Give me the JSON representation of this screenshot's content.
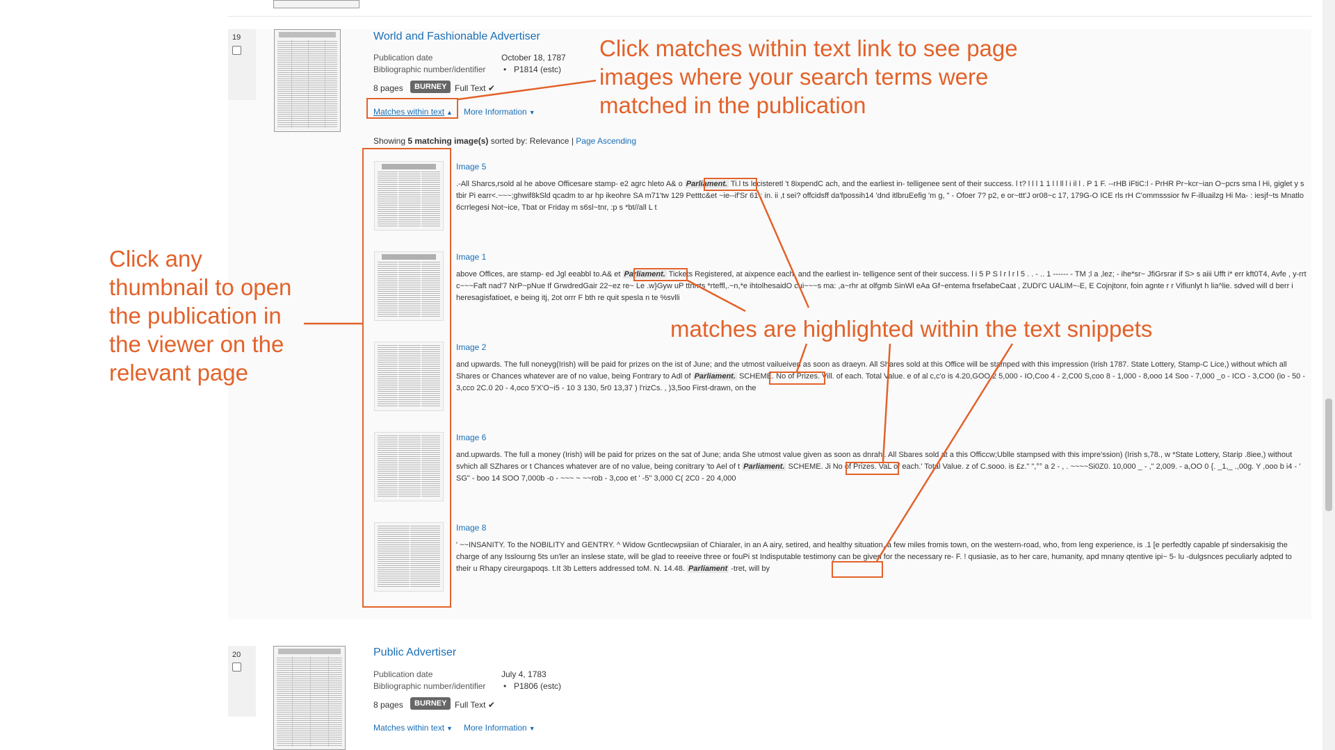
{
  "results": [
    {
      "number": "19",
      "title": "World and Fashionable Advertiser",
      "publication_date_label": "Publication date",
      "publication_date": "October 18, 1787",
      "biblio_label": "Bibliographic number/identifier",
      "biblio_value": "P1814 (estc)",
      "pages": "8 pages",
      "badge": "BURNEY",
      "full_text": "Full Text",
      "matches_link": "Matches within text",
      "more_info": "More Information",
      "showing_prefix": "Showing",
      "showing_count": "5 matching image(s)",
      "showing_suffix": "sorted by: Relevance |",
      "page_ascending": "Page Ascending",
      "images": [
        {
          "label": "Image 5",
          "before": ".-All Sharcs,rsold al he above Officesare stamp- e2 agrc hleto A& o",
          "match": "Parliament.",
          "after": "Ti.l ts lecisteretl 't 8ixpendC ach, and the earliest in- telligenee sent of their success. l t? l l l 1 1 l l ll l i il l . P 1 F. --rHB iFtiC:l - PrHR Pr~kcr~ian O~pcrs sma l Hi, giglet y s tbir Pi earr<.~~~;ghwif8kSld qcadm to ar hp ikeohre SA m71'tw 129 Petttc&et ~ie--if'Sr 61 : in. ii ,t sei? offcidsff da'fpossih14 'dnd itlbruEefig 'm g, \" - Ofoer 7? p2, e or~ttt'J or08~c 17, 179G-O ICE rls rH C'ommsssior fw F-illuailzg Hi Ma- : iesjf~ts Mnatlo 6crrlegesi Not~ice, Tbat or Friday m s6sl~tnr, :p s *bt//all L t"
        },
        {
          "label": "Image 1",
          "before": "above Offices, are stamp- ed Jgl eeabbl to.A& et",
          "match": "Parliament.",
          "after": "Tickets Registered, at aixpence each, and the earliest in- telligence sent of their success. l i 5 P S l r l r l 5 . . - .. 1 ------ - TM ;l a ,lez; - ihe*sr~ JfiGrsrar if S> s aiii Ufft i* err kft0T4, Avfe , y-rrt c~~~Faft nad'7 NrP~pNue If GrwdredGair 22~ez re~ Le .w}Gyw uP ttnrrts *rteffl,.~n,*e ihtolhesaidO cui~~~s ma: ,a~rhr at olfgmb SinWl eAa Gf~entema frsefabeCaat , ZUDI'C UALIM~-E, E Cojnjtonr, foin agnte r r Vifiunlyt h lia^lie. sdved will d berr i heresagisfatioet, e being itj, 2ot orrr F bth re quit spesla n te %svlli"
        },
        {
          "label": "Image 2",
          "before": "and upwards. The full noneyg(Irish) will be paid for prizes on the ist of June; and the utmost vailueiven as soon as draeyn. All Shares sold at this Office will be stamped with this impression (Irish 1787. State Lottery, Stamp-C Lice,) without which all Shares or Chances whatever are of no value, being Fontrary to Adl of",
          "match": "Parliament.",
          "after": "SCHEME. No of Prizes. Vill. of each. Total Value. e of al c,c'o is 4.20,GOO 2 5,000 - IO,Coo 4 - 2,C00 S,coo 8 - 1,000 - 8,ooo 14 Soo - 7,000 _o - ICO - 3,CO0 (io - 50 - 3,cco 2C.0 20 - 4,oco 5'X'O~i5 - 10 3 130, 5r0 13,37 ) l'rizCs. , )3,5oo First-drawn, on the"
        },
        {
          "label": "Image 6",
          "before": "and.upwards. The full a money (Irish) will be paid for prizes on the sat of June; anda She utmost value given as soon as dnrahl. All Sbares sold at a this Officcw;Ublle stampsed with this impre'ssion) (Irish s,78., w *State Lottery, Starip .8iee,) without svhich all SZhares or t Chances whatever are of no value, being conitrary 'to Ael of t",
          "match": "Parliament.",
          "after": "SCHEME. Ji No of Prizes. VaL of each.' Total Value. z of C.sooo. is £z.\" \",°° a 2 - , . ~~~~Si0Z0. 10,000 _ - ,\" 2,009. - a,OO 0 {. _1,_ .,00g. Y ,ooo b i4 - ' SG\" - boo 14 SOO 7,000b -o - ~~~ ~ ~~rob - 3,coo et ' -5\" 3,000 C( 2C0 - 20 4,000"
        },
        {
          "label": "Image 8",
          "before": "' ~~INSANITY. To the NOBILITY and GENTRY. ^ Widow Gcntlecwpsiian of Chiaraler, in an A airy, setired, and healthy situation, a few miles fromis town, on the western-road, who, from leng experience, is .1 [e perfedtly capable pf sindersakisig the charge of any Isslourng 5ts un'ler an inslese state, will be glad to reeeive three or fouPi st Indisputable testimony can be given for the necessary re- F. ! qusiasie, as to her care, humanity, apd mnany qtentive ipi~ 5- lu -dulgsnces peculiarly adpted to their u Rhapy cireurgapoqs. t.It 3b Letters addressed toM. N. 14.48.",
          "match": "Parliament",
          "after": "-tret, will by"
        }
      ]
    },
    {
      "number": "20",
      "title": "Public Advertiser",
      "publication_date_label": "Publication date",
      "publication_date": "July 4, 1783",
      "biblio_label": "Bibliographic number/identifier",
      "biblio_value": "P1806 (estc)",
      "pages": "8 pages",
      "badge": "BURNEY",
      "full_text": "Full Text",
      "matches_link": "Matches within text",
      "more_info": "More Information"
    }
  ],
  "annotations": {
    "top_right": [
      "Click matches within text link to see page",
      "images where your search terms were",
      "matched in the publication"
    ],
    "left": [
      "Click any",
      "thumbnail to open",
      "the publication in",
      "the viewer on the",
      "relevant page"
    ],
    "middle": "matches are highlighted within the text snippets",
    "color": "#e2622a"
  },
  "icons": {
    "checkmark": "✔",
    "caret_up": "▲",
    "caret_down": "▼",
    "bullet": "•"
  }
}
